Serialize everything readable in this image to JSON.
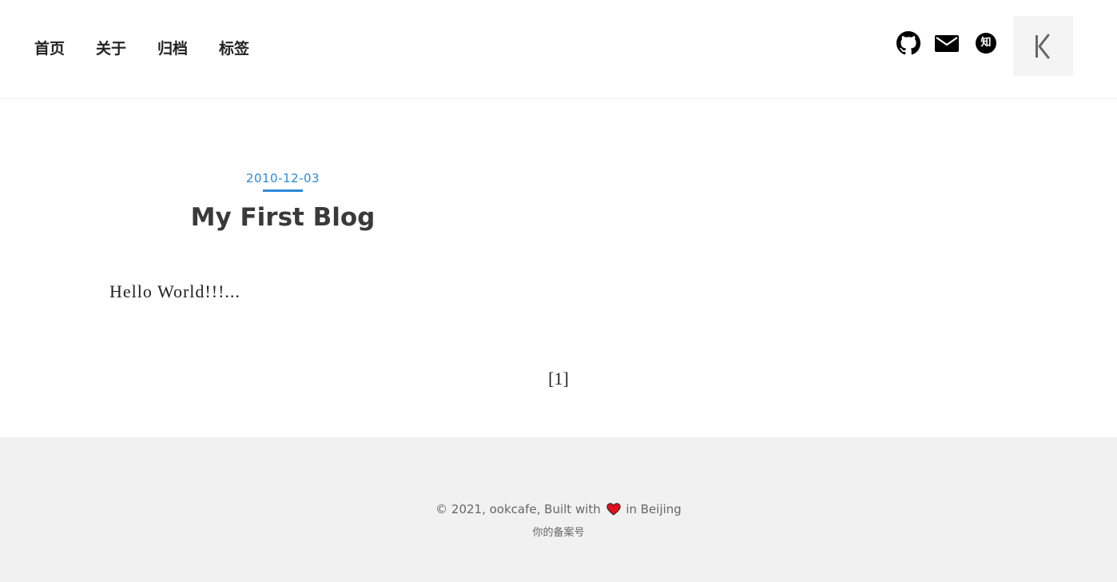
{
  "nav": {
    "items": [
      {
        "label": "首页"
      },
      {
        "label": "关于"
      },
      {
        "label": "归档"
      },
      {
        "label": "标签"
      }
    ]
  },
  "social": {
    "icons": [
      "github-icon",
      "mail-icon",
      "zhihu-icon"
    ],
    "zhihu_glyph": "知"
  },
  "logo": {
    "icon": "k-logo-icon"
  },
  "post": {
    "date": "2010-12-03",
    "title": "My First Blog",
    "excerpt": "Hello World!!!..."
  },
  "pagination": {
    "current": "[1]"
  },
  "footer": {
    "copyright_prefix": "© 2021, ookcafe, Built with",
    "copyright_suffix": "in Beijing",
    "icp": "你的备案号"
  },
  "colors": {
    "accent": "#2b8ad8",
    "heart": "#e0101e",
    "footer_bg": "#f1f1f1"
  }
}
